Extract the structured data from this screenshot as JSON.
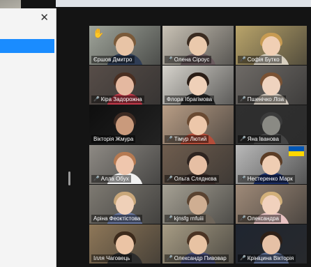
{
  "panel": {
    "close_label": "✕"
  },
  "colors": {
    "active_speaker": "#23d959",
    "muted_mic": "#ff4d4d",
    "accent": "#1a8cff"
  },
  "participants": [
    {
      "name": "Єршов Дмитро",
      "muted": false,
      "raised_hand": true,
      "bg": "#9fa49a",
      "skin": "#e8c4a6",
      "hair": "#7a5a3a",
      "shirt": "#2f3d55"
    },
    {
      "name": "Олена Сіроус",
      "muted": true,
      "bg": "#c9c2b5",
      "skin": "#eac9ac",
      "hair": "#3a2b20",
      "shirt": "#6a5a5e"
    },
    {
      "name": "Софія Бутко",
      "muted": true,
      "bg": "#b9a46a",
      "skin": "#f0cfb4",
      "hair": "#c79b52",
      "shirt": "#d8d0c0"
    },
    {
      "name": "Кіра Задорожна",
      "muted": true,
      "bg": "#574d48",
      "skin": "#e4b8a0",
      "hair": "#4a2f22",
      "shirt": "#c23a4a"
    },
    {
      "name": "Флора Ібрагімова",
      "muted": false,
      "active": true,
      "bg": "#d6d3cc",
      "skin": "#efd0b8",
      "hair": "#2a1d16",
      "shirt": "#2a2a2a"
    },
    {
      "name": "Пшенічко Ліза",
      "muted": true,
      "bg": "#6e6a66",
      "skin": "#efd3bf",
      "hair": "#7a5234",
      "shirt": "#cfc6bb"
    },
    {
      "name": "Вікторія Жмура",
      "muted": false,
      "bg": "#0e0e0e",
      "skin": "#c99a7c",
      "hair": "#3c2a22",
      "shirt": "#1d1d1d"
    },
    {
      "name": "Тімур Лютий",
      "muted": true,
      "bg": "#b89d85",
      "skin": "#edc7aa",
      "hair": "#6a4a32",
      "shirt": "#b44d3a"
    },
    {
      "name": "Яна Іванова",
      "muted": true,
      "bg": "#2f2f2f",
      "skin": "#8a8a84",
      "hair": "#3b3b3b",
      "shirt": "#444"
    },
    {
      "name": "Алла Обух",
      "muted": true,
      "bg": "#8e8a84",
      "skin": "#efc6ad",
      "hair": "#b67a52",
      "shirt": "#f1f1f1"
    },
    {
      "name": "Ольга Сляднєва",
      "muted": true,
      "bg": "#6f5d4e",
      "skin": "#e6bfa4",
      "hair": "#2e2420",
      "shirt": "#3c2e2a"
    },
    {
      "name": "Нестеренко Марк",
      "muted": true,
      "flag": true,
      "bg": "#b9b9b9",
      "skin": "#efcdb3",
      "hair": "#5b3c25",
      "shirt": "#1c2f66"
    },
    {
      "name": "Аріна Феоктістова",
      "muted": false,
      "bg": "#7e7a72",
      "skin": "#efd0b8",
      "hair": "#c9a77a",
      "shirt": "#6c7aa3"
    },
    {
      "name": "kjnsfg rnfuiii",
      "muted": true,
      "bg": "#a6a194",
      "skin": "#cfae92",
      "hair": "#5a4331",
      "shirt": "#6e655a"
    },
    {
      "name": "Олександра",
      "muted": true,
      "bg": "#9f8a78",
      "skin": "#f1d1bd",
      "hair": "#d2b07a",
      "shirt": "#e9c3c3"
    },
    {
      "name": "Ілля Чаговець",
      "muted": false,
      "bg": "#8e7758",
      "skin": "#ebc4a5",
      "hair": "#3d2b1c",
      "shirt": "#2d2d2d"
    },
    {
      "name": "Олександр Пивовар",
      "muted": true,
      "bg": "#a79c84",
      "skin": "#e8c3a3",
      "hair": "#4b3424",
      "shirt": "#4a4f7a"
    },
    {
      "name": "Крініцина Вікторія",
      "muted": true,
      "bg": "#1f2530",
      "skin": "#e6c1a6",
      "hair": "#2e2018",
      "shirt": "#5d6d92"
    }
  ]
}
